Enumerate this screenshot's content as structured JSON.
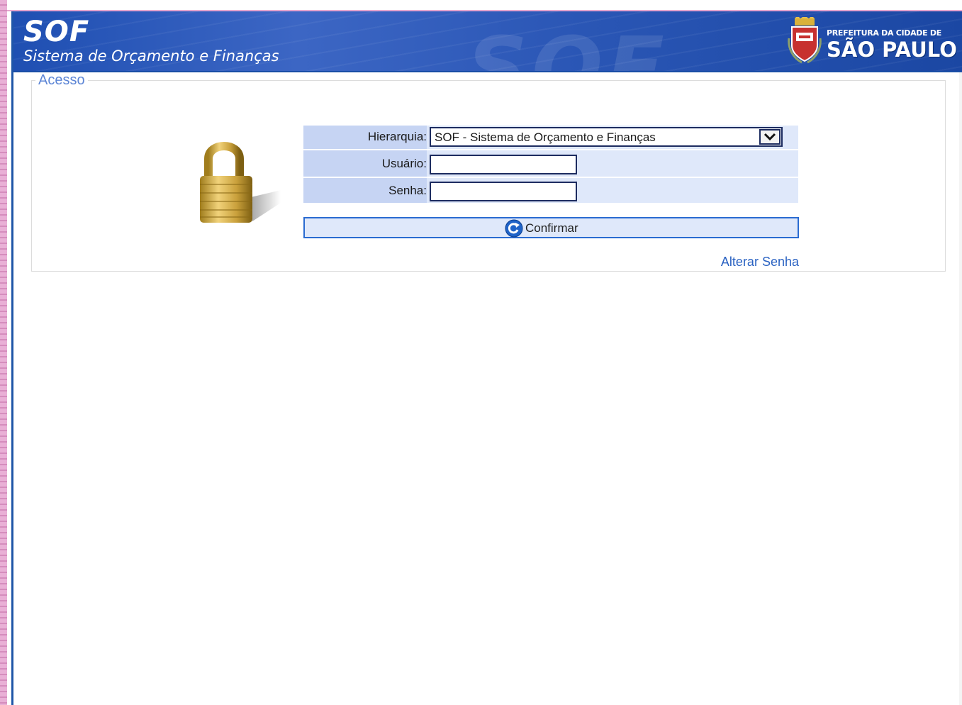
{
  "header": {
    "title": "SOF",
    "subtitle": "Sistema de Orçamento e Finanças",
    "city_prefix": "PREFEITURA DA CIDADE DE",
    "city_name": "SÃO PAULO"
  },
  "access": {
    "legend": "Acesso",
    "hierarchy_label": "Hierarquia:",
    "hierarchy_value": "SOF - Sistema de Orçamento e Finanças",
    "user_label": "Usuário:",
    "user_value": "",
    "password_label": "Senha:",
    "password_value": "",
    "confirm_label": "Confirmar",
    "alter_password_link": "Alterar Senha"
  },
  "icons": {
    "lock": "padlock-icon",
    "confirm": "refresh-arrow-icon",
    "dropdown": "chevron-down-icon",
    "city_logo": "city-coat-of-arms-icon"
  },
  "colors": {
    "header_blue": "#2a56b5",
    "accent_blue": "#2a62c2",
    "row_bg": "#dfe8fa",
    "label_bg": "#c6d4f3"
  }
}
